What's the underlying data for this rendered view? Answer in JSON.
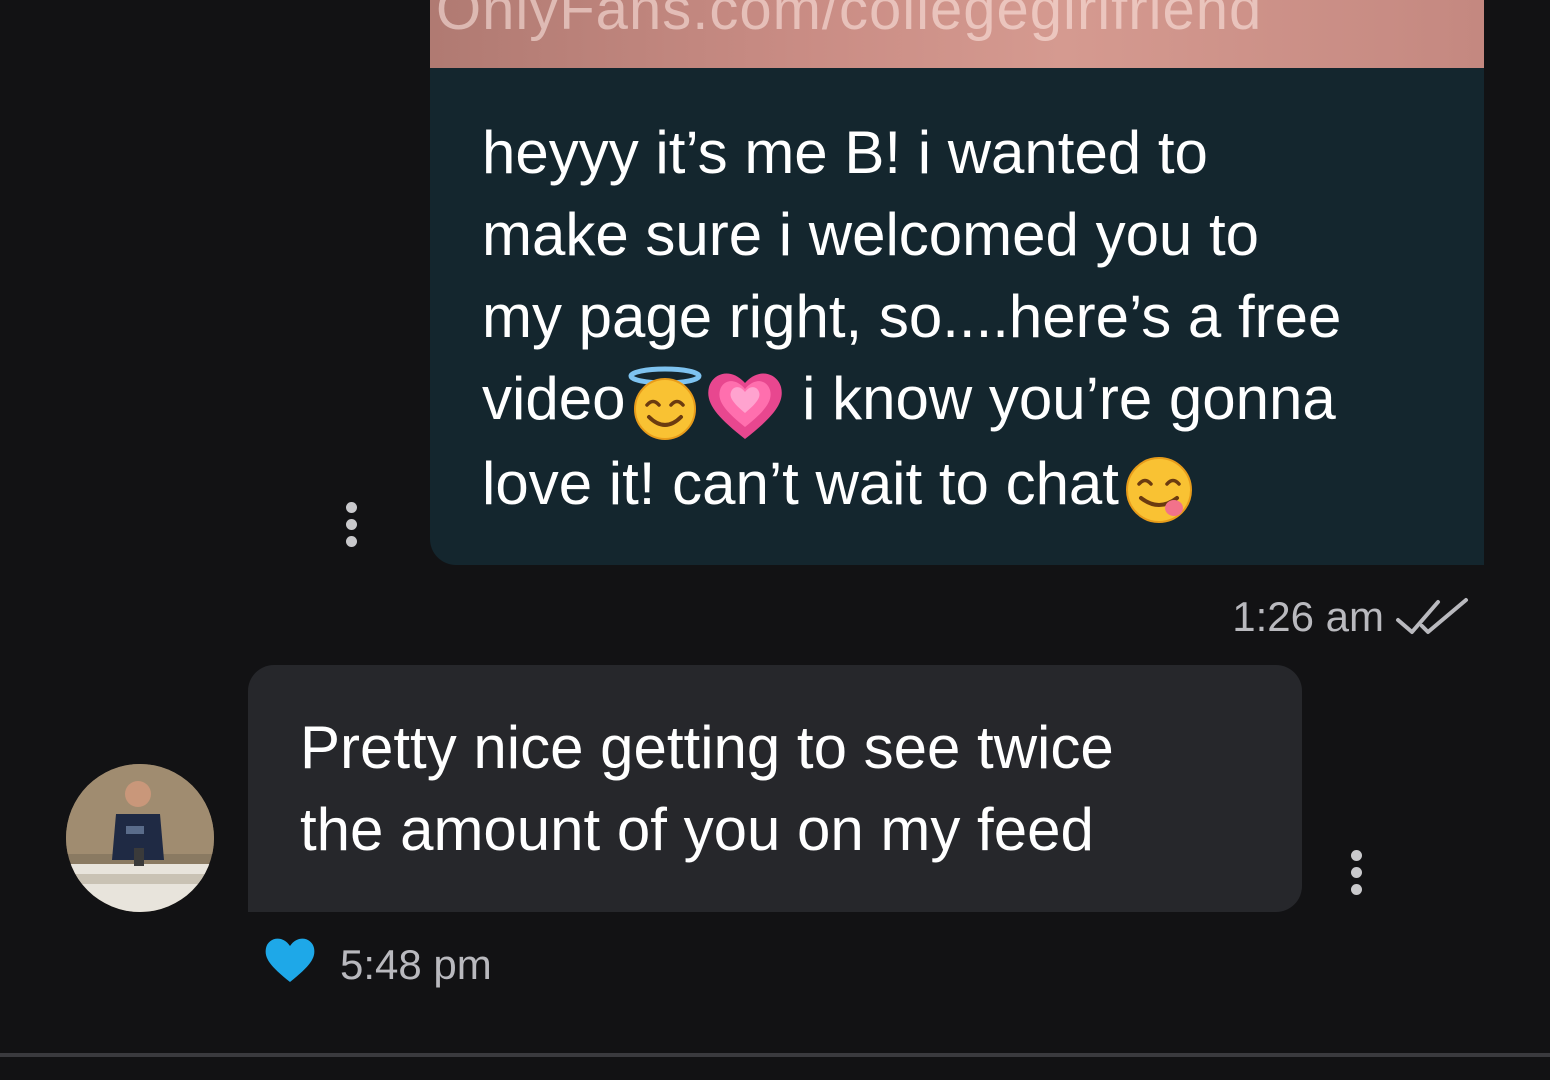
{
  "chat": {
    "outgoing": {
      "media_watermark": "OnlyFans.com/collegegirlfriend",
      "line1": "heyyy it’s me B! i wanted to",
      "line2": "make sure i welcomed you to",
      "line3": "my page right, so....here’s a free",
      "line4_a": "video",
      "line4_b": " i know you’re gonna",
      "line5": "love it! can’t wait to chat",
      "emojis": [
        "smiling-face-with-halo-emoji",
        "growing-heart-emoji",
        "face-savoring-food-emoji"
      ],
      "time": "1:26 am",
      "status_icon": "double-check-read-icon"
    },
    "incoming": {
      "line1": "Pretty nice getting to see twice",
      "line2": "the amount of you on my feed",
      "time": "5:48 pm",
      "liked": true,
      "like_icon": "heart-icon",
      "avatar": "user-avatar"
    },
    "colors": {
      "background": "#121214",
      "outgoing_bubble": "#14262e",
      "incoming_bubble": "#26272b",
      "like_heart": "#1ea8e8",
      "timestamp": "#b9b9be"
    }
  }
}
